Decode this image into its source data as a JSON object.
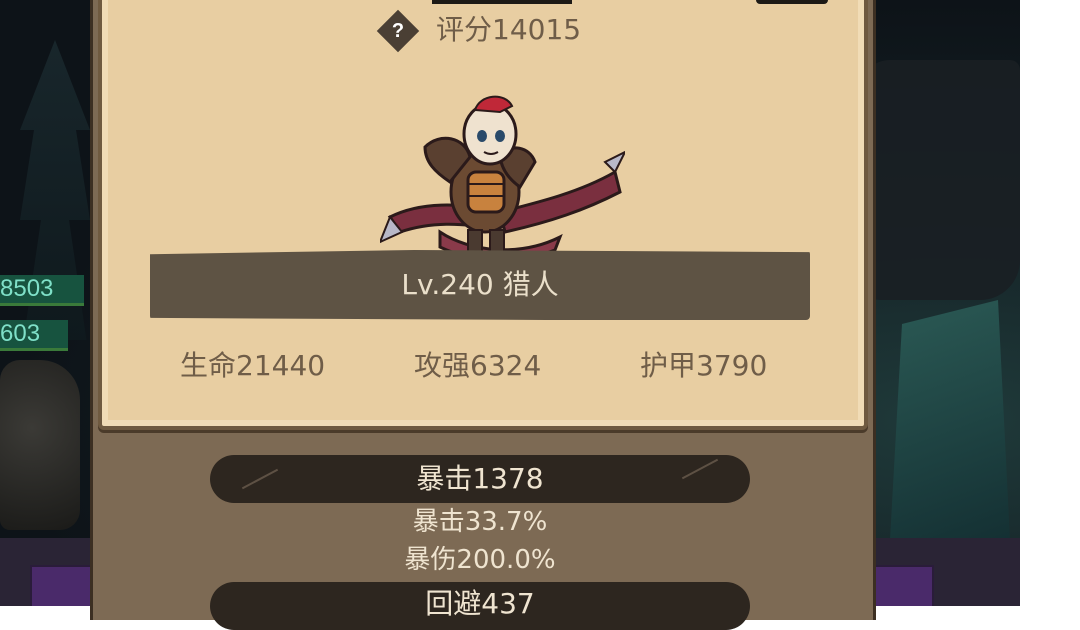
{
  "background": {
    "hp_labels": [
      "8503",
      "603"
    ]
  },
  "panel": {
    "help_icon_glyph": "?",
    "score_text": "评分14015",
    "hero_banner_text": "Lv.240 猎人",
    "stats": {
      "hp": "生命21440",
      "attack": "攻强6324",
      "armor": "护甲3790"
    },
    "details": {
      "crit_rating": "暴击1378",
      "crit_chance": "暴击33.7%",
      "crit_damage": "暴伤200.0%",
      "dodge_rating": "回避437"
    }
  },
  "colors": {
    "card_bg": "#e8cea2",
    "panel_bg": "#7d6a54",
    "banner_bg": "#5e5344",
    "pill_bg": "#2d261f",
    "text_brown": "#6f5d48"
  }
}
